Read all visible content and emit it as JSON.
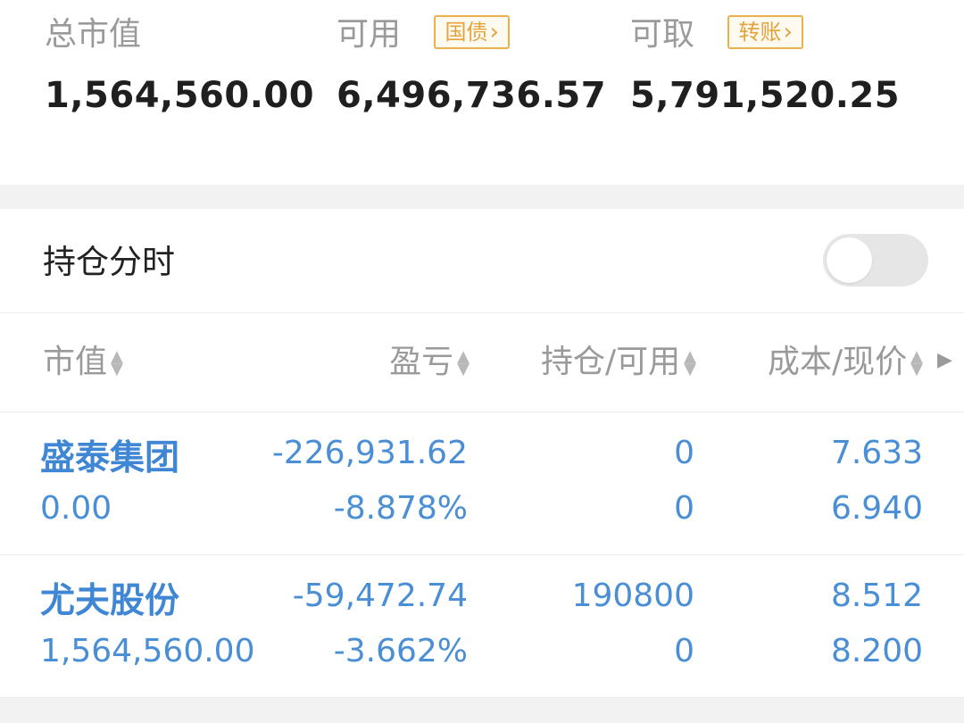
{
  "summary": {
    "total_market_value": {
      "label": "总市值",
      "value": "1,564,560.00"
    },
    "available": {
      "label": "可用",
      "tag": "国债",
      "value": "6,496,736.57"
    },
    "withdrawable": {
      "label": "可取",
      "tag": "转账",
      "value": "5,791,520.25"
    }
  },
  "holdings": {
    "title": "持仓分时",
    "toggle_on": false
  },
  "columns": {
    "market_value": "市值",
    "profit_loss": "盈亏",
    "position_available": "持仓/可用",
    "cost_price": "成本/现价"
  },
  "rows": [
    {
      "name": "盛泰集团",
      "market_value": "0.00",
      "profit_loss": "-226,931.62",
      "profit_loss_pct": "-8.878%",
      "position": "0",
      "available": "0",
      "cost": "7.633",
      "price": "6.940"
    },
    {
      "name": "尤夫股份",
      "market_value": "1,564,560.00",
      "profit_loss": "-59,472.74",
      "profit_loss_pct": "-3.662%",
      "position": "190800",
      "available": "0",
      "cost": "8.512",
      "price": "8.200"
    }
  ],
  "colors": {
    "accent_tag": "#e2a23c",
    "loss_blue": "#4a8ed6",
    "muted_text": "#9a9a9a"
  }
}
